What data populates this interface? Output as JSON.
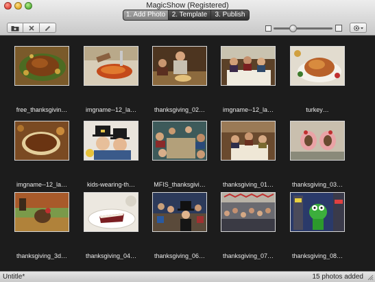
{
  "window": {
    "title": "MagicShow (Registered)"
  },
  "steps": [
    {
      "label": "1. Add Photo",
      "active": true
    },
    {
      "label": "2. Template",
      "active": false
    },
    {
      "label": "3. Publish",
      "active": false
    }
  ],
  "toolbar": {
    "icons": [
      "folder-add-icon",
      "delete-x-icon",
      "edit-pencil-icon"
    ],
    "zoom_slider_value": 0.3,
    "settings_icon": "gear-icon"
  },
  "photos": [
    {
      "caption": "free_thanksgivin…",
      "scene": "dark-roast-platter"
    },
    {
      "caption": "imgname--12_la…",
      "scene": "carving-roast"
    },
    {
      "caption": "thanksgiving_02…",
      "scene": "family-table-man"
    },
    {
      "caption": "imgname--12_la…",
      "scene": "family-table-people"
    },
    {
      "caption": "turkey…",
      "scene": "roast-turkey-platter"
    },
    {
      "caption": "imgname--12_la…",
      "scene": "pie-on-table"
    },
    {
      "caption": "kids-wearing-th…",
      "scene": "kids-pilgrim-hats"
    },
    {
      "caption": "MFIS_thanksgivi…",
      "scene": "kids-at-long-table"
    },
    {
      "caption": "thanksgiving_01…",
      "scene": "family-dinner-room"
    },
    {
      "caption": "thanksgiving_03…",
      "scene": "turkey-hands-art"
    },
    {
      "caption": "thanksgiving_3d…",
      "scene": "3d-turkey-field"
    },
    {
      "caption": "thanksgiving_04…",
      "scene": "pie-slice-plate"
    },
    {
      "caption": "thanksgiving_06…",
      "scene": "parade-crowd-pilgrims"
    },
    {
      "caption": "thanksgiving_07…",
      "scene": "parade-street-crowd"
    },
    {
      "caption": "thanksgiving_08…",
      "scene": "kermit-balloon-parade"
    }
  ],
  "status": {
    "left": "Untitle*",
    "right": "15 photos added"
  },
  "colors": {
    "background": "#1c1c1c",
    "caption": "#ececec",
    "active_step": "#8f8f8f"
  }
}
